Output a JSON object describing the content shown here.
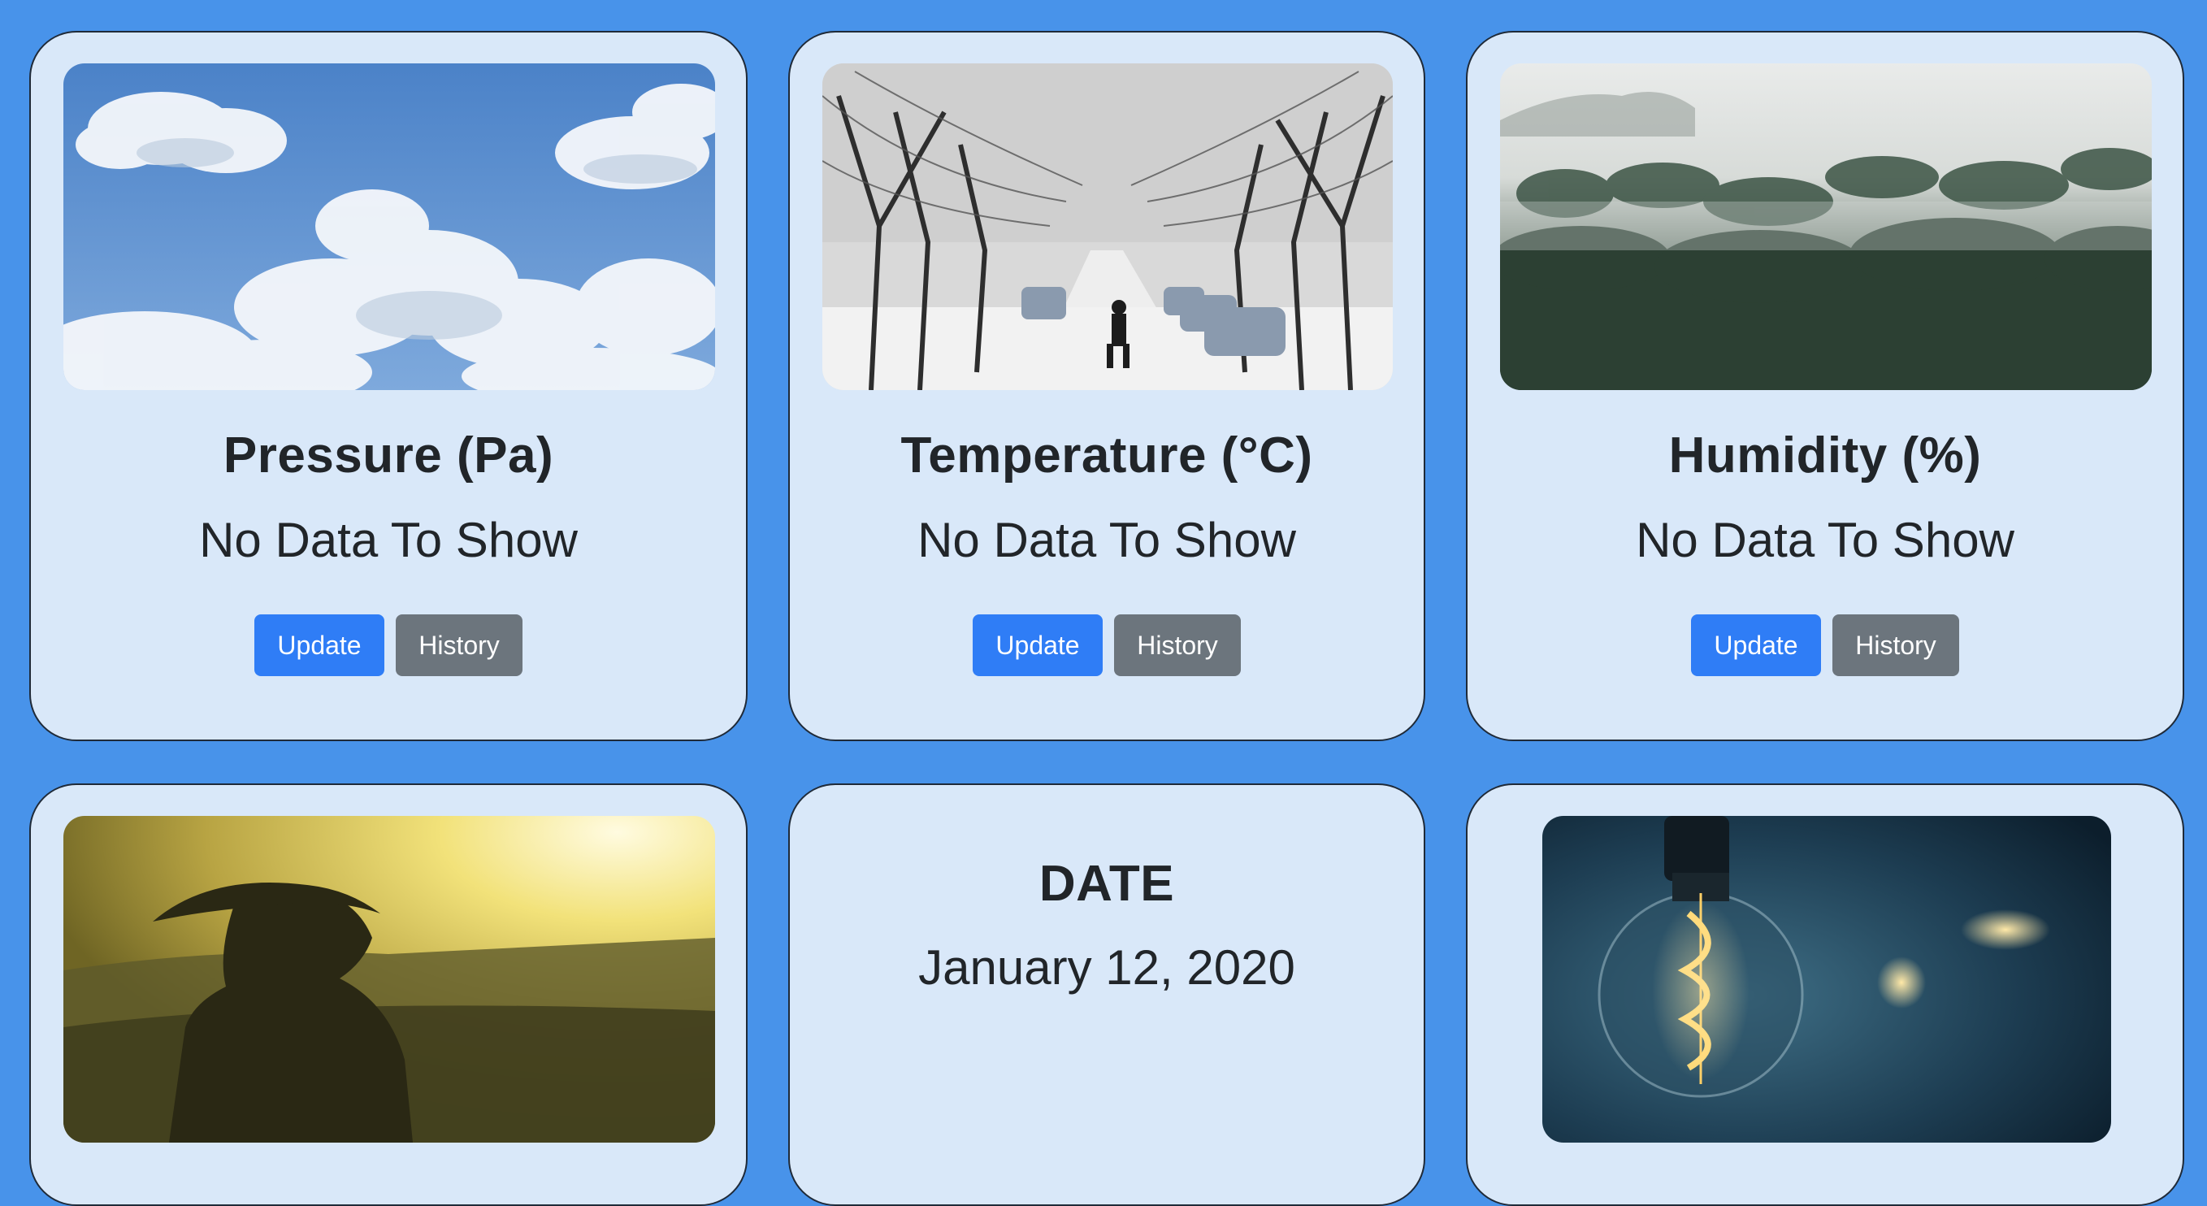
{
  "colors": {
    "page_background": "#4893ea",
    "card_background": "#d9e8f9",
    "primary_button": "#2f7df6",
    "secondary_button": "#6c757d"
  },
  "cards": [
    {
      "image": "clouds-sky-photo",
      "title": "Pressure (Pa)",
      "value": "No Data To Show",
      "update_label": "Update",
      "history_label": "History"
    },
    {
      "image": "snowy-street-photo",
      "title": "Temperature (°C)",
      "value": "No Data To Show",
      "update_label": "Update",
      "history_label": "History"
    },
    {
      "image": "misty-forest-photo",
      "title": "Humidity (%)",
      "value": "No Data To Show",
      "update_label": "Update",
      "history_label": "History"
    },
    {
      "image": "sunset-silhouette-photo"
    },
    {
      "title": "DATE",
      "value": "January 12, 2020"
    },
    {
      "image": "light-bulb-photo"
    }
  ]
}
